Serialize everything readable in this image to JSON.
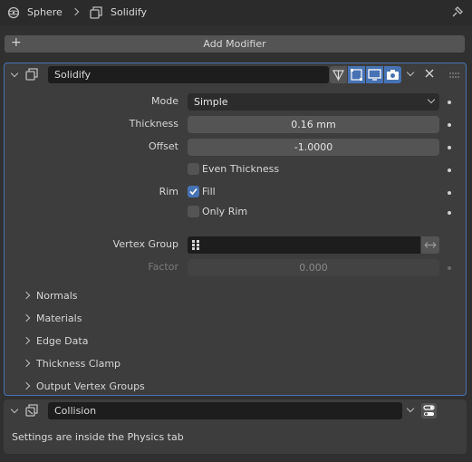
{
  "breadcrumb": {
    "object": "Sphere",
    "modifier": "Solidify"
  },
  "add_modifier_label": "Add Modifier",
  "solidify": {
    "name": "Solidify",
    "mode_label": "Mode",
    "mode_value": "Simple",
    "thickness_label": "Thickness",
    "thickness_value": "0.16 mm",
    "offset_label": "Offset",
    "offset_value": "-1.0000",
    "even_thickness_label": "Even Thickness",
    "even_thickness_checked": false,
    "rim_label": "Rim",
    "fill_label": "Fill",
    "fill_checked": true,
    "only_rim_label": "Only Rim",
    "only_rim_checked": false,
    "vertex_group_label": "Vertex Group",
    "vertex_group_value": "",
    "factor_label": "Factor",
    "factor_value": "0.000",
    "subpanels": [
      "Normals",
      "Materials",
      "Edge Data",
      "Thickness Clamp",
      "Output Vertex Groups"
    ]
  },
  "collision": {
    "name": "Collision",
    "info": "Settings are inside the Physics tab"
  },
  "colors": {
    "accent": "#4772b3",
    "panel_border": "#4772b3",
    "bg": "#303030"
  }
}
